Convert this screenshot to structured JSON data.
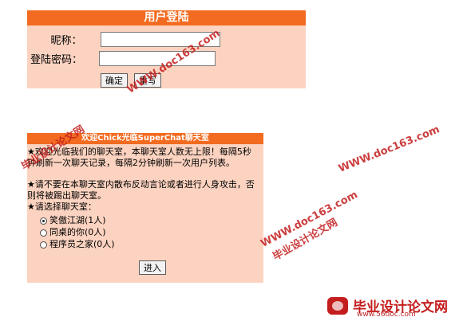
{
  "login": {
    "title": "用户登陆",
    "nickname_label": "昵称：",
    "nickname_value": "",
    "password_label": "登陆密码：",
    "password_value": "",
    "confirm_label": "确定",
    "reset_label": "重写"
  },
  "chat": {
    "title": "欢迎Chick光临SuperChat聊天室",
    "welcome_text": "★欢迎光临我们的聊天室，本聊天室人数无上限！每隔5秒钟刷新一次聊天记录，每隔2分钟刷新一次用户列表。",
    "rules_text": "★请不要在本聊天室内散布反动言论或者进行人身攻击，否则将被踢出聊天室。",
    "choose_label": "★请选择聊天室：",
    "rooms": [
      {
        "label": "笑傲江湖(1人)",
        "checked": true
      },
      {
        "label": "同桌的你(0人)",
        "checked": false
      },
      {
        "label": "程序员之家(0人)",
        "checked": false
      }
    ],
    "enter_label": "进入"
  },
  "watermarks": {
    "site_url": "WWW.doc163.com",
    "site_name": "毕业设计论文网",
    "logo_name": "毕业设计论文网",
    "logo_url": "www.56doc.com"
  },
  "colors": {
    "header": "#f26b20",
    "panel": "#fcd3c0",
    "watermark": "#c41d1d"
  }
}
